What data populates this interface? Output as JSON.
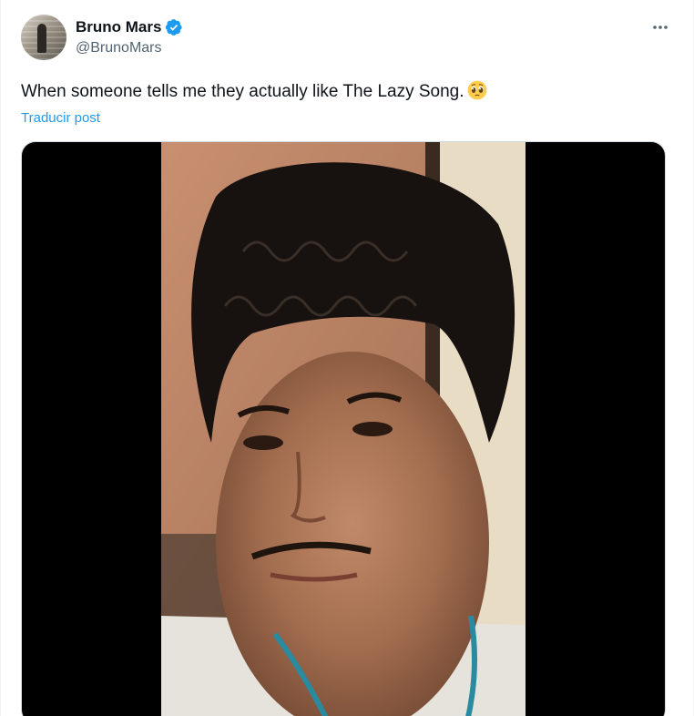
{
  "user": {
    "display_name": "Bruno Mars",
    "handle": "@BrunoMars",
    "verified": true,
    "avatar_icon": "profile-photo"
  },
  "tweet": {
    "text": "When someone tells me they actually like The Lazy Song.",
    "emoji": "pleading-face-emoji",
    "translate_label": "Traducir post"
  },
  "media": {
    "type": "video",
    "description_icon": "video-frame"
  },
  "colors": {
    "accent": "#1d9bf0",
    "secondary_text": "#536471",
    "primary_text": "#0f1419",
    "verified_badge": "#1d9bf0"
  }
}
